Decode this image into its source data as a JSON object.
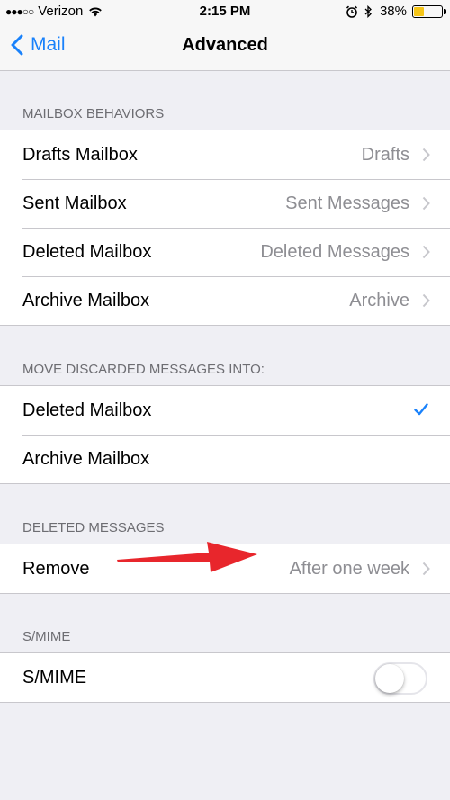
{
  "status_bar": {
    "signal_dots": "●●●○○",
    "carrier": "Verizon",
    "time": "2:15 PM",
    "battery_percent": "38%",
    "battery_level": 0.38,
    "icons": [
      "signal-icon",
      "wifi-icon",
      "alarm-icon",
      "bluetooth-icon",
      "battery-icon"
    ]
  },
  "nav": {
    "back_label": "Mail",
    "title": "Advanced"
  },
  "sections": {
    "mailbox_behaviors": {
      "header": "MAILBOX BEHAVIORS",
      "rows": [
        {
          "label": "Drafts Mailbox",
          "value": "Drafts"
        },
        {
          "label": "Sent Mailbox",
          "value": "Sent Messages"
        },
        {
          "label": "Deleted Mailbox",
          "value": "Deleted Messages"
        },
        {
          "label": "Archive Mailbox",
          "value": "Archive"
        }
      ]
    },
    "move_discarded": {
      "header": "MOVE DISCARDED MESSAGES INTO:",
      "rows": [
        {
          "label": "Deleted Mailbox",
          "selected": true
        },
        {
          "label": "Archive Mailbox",
          "selected": false
        }
      ]
    },
    "deleted_messages": {
      "header": "DELETED MESSAGES",
      "rows": [
        {
          "label": "Remove",
          "value": "After one week"
        }
      ]
    },
    "smime": {
      "header": "S/MIME",
      "rows": [
        {
          "label": "S/MIME",
          "enabled": false
        }
      ]
    }
  },
  "colors": {
    "accent": "#1a82fb",
    "background": "#efeff4",
    "secondary_text": "#8e8e93",
    "annotation_arrow": "#e8262c"
  }
}
